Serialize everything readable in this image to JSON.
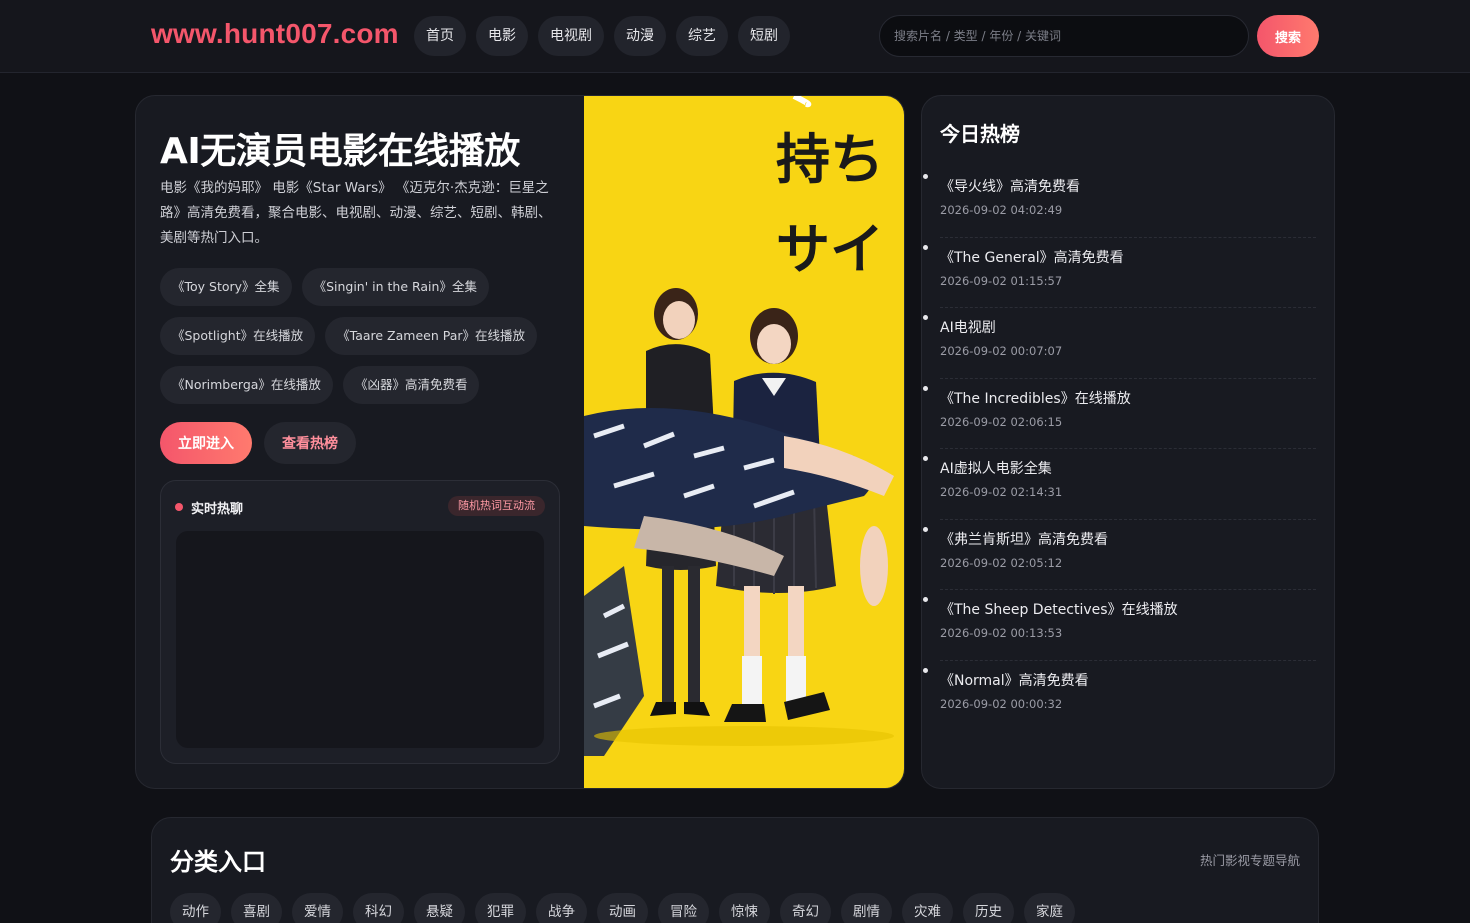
{
  "header": {
    "logo": "www.hunt007.com",
    "nav": [
      "首页",
      "电影",
      "电视剧",
      "动漫",
      "综艺",
      "短剧"
    ],
    "search_placeholder": "搜索片名 / 类型 / 年份 / 关键词",
    "search_button": "搜索"
  },
  "hero": {
    "title": "AI无演员电影在线播放",
    "description": "电影《我的妈耶》 电影《Star Wars》 《迈克尔·杰克逊：巨星之路》高清免费看，聚合电影、电视剧、动漫、综艺、短剧、韩剧、美剧等热门入口。",
    "tags": [
      "《Toy Story》全集",
      "《Singin' in the Rain》全集",
      "《Spotlight》在线播放",
      "《Taare Zameen Par》在线播放",
      "《Norimberga》在线播放",
      "《凶器》高清免费看"
    ],
    "enter_button": "立即进入",
    "rank_button": "查看热榜",
    "chat": {
      "title": "实时热聊",
      "badge": "随机热词互动流"
    },
    "poster": {
      "text_line1": "持ち",
      "text_line2": "サイ"
    }
  },
  "hot": {
    "title": "今日热榜",
    "items": [
      {
        "name": "《导火线》高清免费看",
        "time": "2026-09-02 04:02:49"
      },
      {
        "name": "《The General》高清免费看",
        "time": "2026-09-02 01:15:57"
      },
      {
        "name": "AI电视剧",
        "time": "2026-09-02 00:07:07"
      },
      {
        "name": "《The Incredibles》在线播放",
        "time": "2026-09-02 02:06:15"
      },
      {
        "name": "AI虚拟人电影全集",
        "time": "2026-09-02 02:14:31"
      },
      {
        "name": "《弗兰肯斯坦》高清免费看",
        "time": "2026-09-02 02:05:12"
      },
      {
        "name": "《The Sheep Detectives》在线播放",
        "time": "2026-09-02 00:13:53"
      },
      {
        "name": "《Normal》高清免费看",
        "time": "2026-09-02 00:00:32"
      }
    ]
  },
  "category": {
    "title": "分类入口",
    "subtitle": "热门影视专题导航",
    "items": [
      "动作",
      "喜剧",
      "爱情",
      "科幻",
      "悬疑",
      "犯罪",
      "战争",
      "动画",
      "冒险",
      "惊悚",
      "奇幻",
      "剧情",
      "灾难",
      "历史",
      "家庭"
    ]
  },
  "colors": {
    "accent": "#f4566b",
    "background": "#101116",
    "card": "#181a21",
    "poster_bg": "#f8d514"
  }
}
